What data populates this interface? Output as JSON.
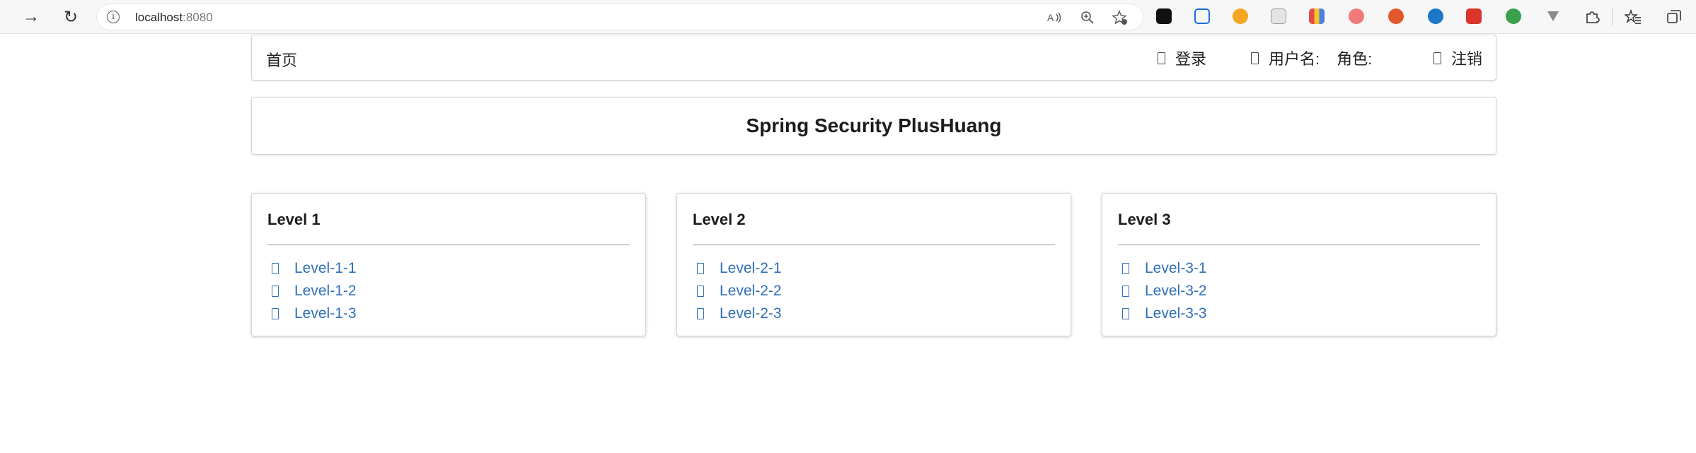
{
  "browser": {
    "back_icon": "→",
    "reload_icon": "↻",
    "url_host": "localhost",
    "url_port": ":8080",
    "tools": [
      "read-aloud-icon",
      "zoom-icon",
      "favorite-icon"
    ],
    "extensions": [
      {
        "name": "ext-black-icon",
        "color": "#111111"
      },
      {
        "name": "ext-crop-icon",
        "color": "#1a6fe0"
      },
      {
        "name": "ext-orange-icon",
        "color": "#f5a623"
      },
      {
        "name": "ext-doc-icon",
        "color": "#9a9a9a"
      },
      {
        "name": "ext-grid-icon",
        "color": "#7b4dd1"
      },
      {
        "name": "ext-pink-icon",
        "color": "#f07a7a"
      },
      {
        "name": "ext-paint-icon",
        "color": "#e2582a"
      },
      {
        "name": "ext-cloud-icon",
        "color": "#1b78c8"
      },
      {
        "name": "ext-todo-icon",
        "color": "#d9352b"
      },
      {
        "name": "ext-globe-icon",
        "color": "#3aa04a"
      },
      {
        "name": "ext-v-icon",
        "color": "#8a8a8a"
      }
    ]
  },
  "nav": {
    "home": "首页",
    "login": "登录",
    "username_label": "用户名:",
    "role_label": "角色:",
    "logout": "注销"
  },
  "header": {
    "title": "Spring Security PlusHuang"
  },
  "cards": [
    {
      "title": "Level 1",
      "links": [
        "Level-1-1",
        "Level-1-2",
        "Level-1-3"
      ]
    },
    {
      "title": "Level 2",
      "links": [
        "Level-2-1",
        "Level-2-2",
        "Level-2-3"
      ]
    },
    {
      "title": "Level 3",
      "links": [
        "Level-3-1",
        "Level-3-2",
        "Level-3-3"
      ]
    }
  ],
  "colors": {
    "link": "#2f6fb8",
    "border": "#d4d4d5"
  }
}
